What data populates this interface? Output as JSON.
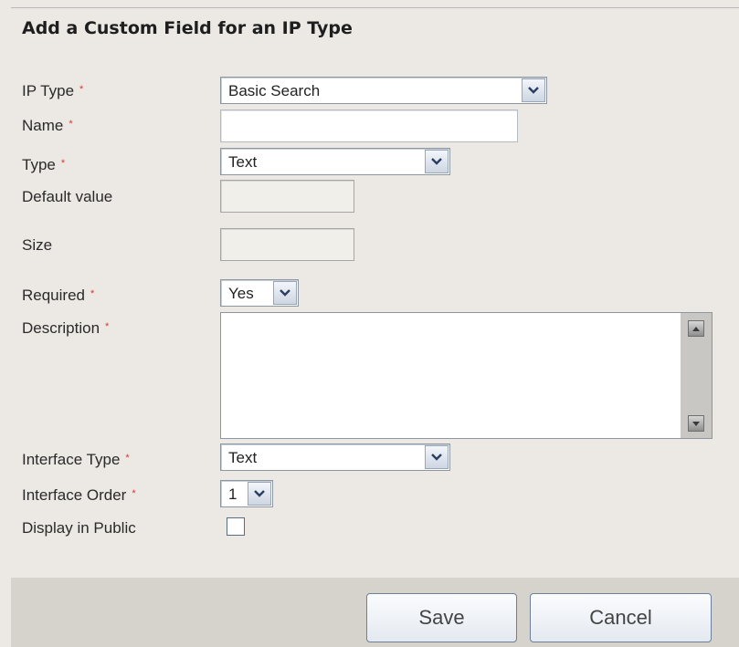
{
  "title": "Add a Custom Field for an IP Type",
  "required_mark": "*",
  "fields": {
    "ip_type": {
      "label": "IP Type",
      "value": "Basic Search"
    },
    "name": {
      "label": "Name",
      "value": ""
    },
    "type": {
      "label": "Type",
      "value": "Text"
    },
    "default_value": {
      "label": "Default value",
      "value": ""
    },
    "size": {
      "label": "Size",
      "value": ""
    },
    "required": {
      "label": "Required",
      "value": "Yes"
    },
    "description": {
      "label": "Description",
      "value": ""
    },
    "interface_type": {
      "label": "Interface Type",
      "value": "Text"
    },
    "interface_order": {
      "label": "Interface Order",
      "value": "1"
    },
    "display_in_public": {
      "label": "Display in Public",
      "checked": false
    }
  },
  "buttons": {
    "save": "Save",
    "cancel": "Cancel"
  },
  "colors": {
    "required_mark": "#dd3333",
    "background": "#ece9e4",
    "footer": "#d6d3cd"
  }
}
